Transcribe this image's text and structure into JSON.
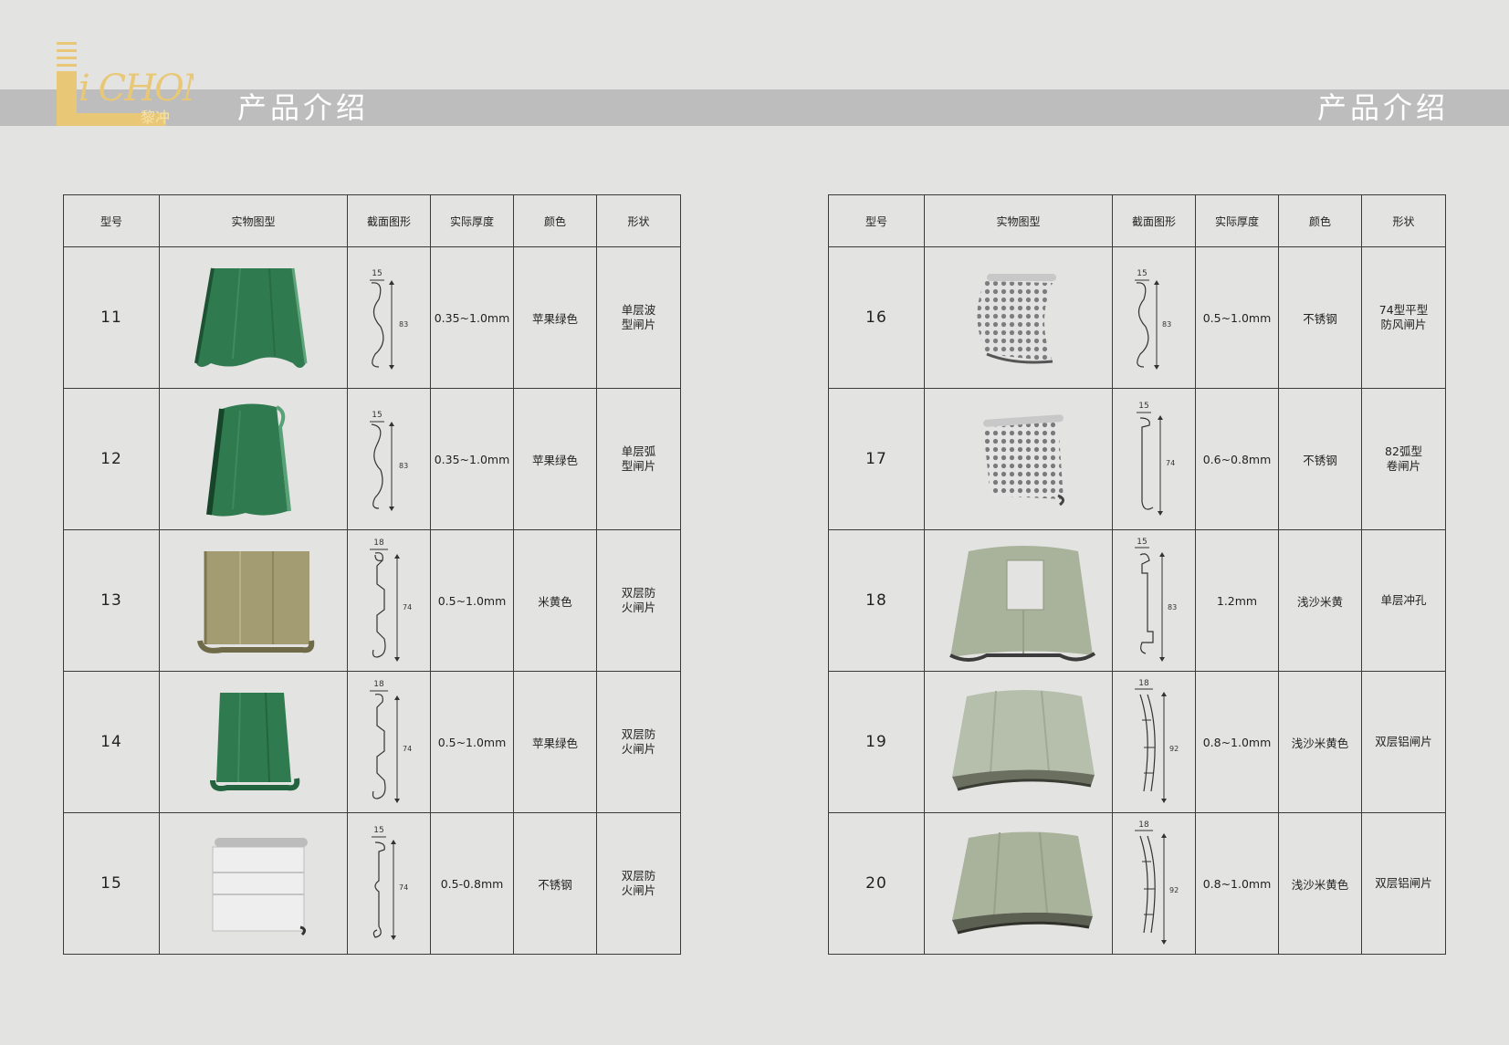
{
  "header": {
    "left_title": "产品介绍",
    "right_title": "产品介绍",
    "logo": {
      "brand": "LICHONG",
      "brand_cn": "黎冲"
    }
  },
  "columns": [
    "型号",
    "实物图型",
    "截面图形",
    "实际厚度",
    "颜色",
    "形状"
  ],
  "left_table": [
    {
      "model": "11",
      "image": "green-wave-slat-photo",
      "dims": [
        "15",
        "83"
      ],
      "thickness": "0.35~1.0mm",
      "color": "苹果绿色",
      "shape": [
        "单层波",
        "型闸片"
      ]
    },
    {
      "model": "12",
      "image": "green-arc-slat-photo",
      "dims": [
        "15",
        "83"
      ],
      "thickness": "0.35~1.0mm",
      "color": "苹果绿色",
      "shape": [
        "单层弧",
        "型闸片"
      ]
    },
    {
      "model": "13",
      "image": "beige-fireproof-slat-photo",
      "dims": [
        "18",
        "74"
      ],
      "thickness": "0.5~1.0mm",
      "color": "米黄色",
      "shape": [
        "双层防",
        "火闸片"
      ]
    },
    {
      "model": "14",
      "image": "green-fireproof-slat-photo",
      "dims": [
        "18",
        "74"
      ],
      "thickness": "0.5~1.0mm",
      "color": "苹果绿色",
      "shape": [
        "双层防",
        "火闸片"
      ]
    },
    {
      "model": "15",
      "image": "stainless-fireproof-slat-photo",
      "dims": [
        "15",
        "74"
      ],
      "thickness": "0.5-0.8mm",
      "color": "不锈钢",
      "shape": [
        "双层防",
        "火闸片"
      ]
    }
  ],
  "right_table": [
    {
      "model": "16",
      "image": "perforated-74-slat-photo",
      "dims": [
        "15",
        "83"
      ],
      "thickness": "0.5~1.0mm",
      "color": "不锈钢",
      "shape": [
        "74型平型",
        "防风闸片"
      ]
    },
    {
      "model": "17",
      "image": "perforated-82-slat-photo",
      "dims": [
        "15",
        "74"
      ],
      "thickness": "0.6~0.8mm",
      "color": "不锈钢",
      "shape": [
        "82弧型",
        "卷闸片"
      ]
    },
    {
      "model": "18",
      "image": "punched-slat-photo",
      "dims": [
        "15",
        "83"
      ],
      "thickness": "1.2mm",
      "color": "浅沙米黄",
      "shape": [
        "单层冲孔"
      ]
    },
    {
      "model": "19",
      "image": "double-aluminium-slat-photo",
      "dims": [
        "18",
        "92"
      ],
      "thickness": "0.8~1.0mm",
      "color": "浅沙米黄色",
      "shape": [
        "双层铝闸片"
      ]
    },
    {
      "model": "20",
      "image": "double-aluminium-slat-photo-2",
      "dims": [
        "18",
        "92"
      ],
      "thickness": "0.8~1.0mm",
      "color": "浅沙米黄色",
      "shape": [
        "双层铝闸片"
      ]
    }
  ],
  "colors": {
    "apple_green": "#2f7a4f",
    "beige": "#a39c72",
    "stainless": "#d6d6d6",
    "sand": "#a9b29b",
    "logo_gold": "#e8c877"
  }
}
